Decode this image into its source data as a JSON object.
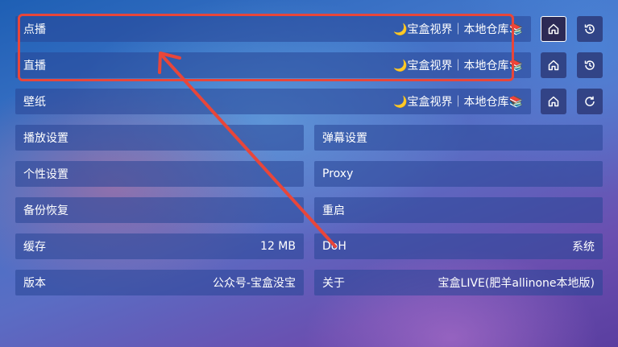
{
  "source_rows": [
    {
      "label": "点播",
      "value": "🌙宝盒视界｜本地仓库📚",
      "btn1": "home-icon",
      "btn2": "history-icon"
    },
    {
      "label": "直播",
      "value": "🌙宝盒视界｜本地仓库📚",
      "btn1": "home-icon",
      "btn2": "history-icon"
    },
    {
      "label": "壁纸",
      "value": "🌙宝盒视界｜本地仓库📚",
      "btn1": "home-icon",
      "btn2": "refresh-icon"
    }
  ],
  "settings": {
    "play_settings": "播放设置",
    "danmaku_settings": "弹幕设置",
    "personalize": "个性设置",
    "proxy": "Proxy",
    "backup": "备份恢复",
    "restart": "重启",
    "cache_label": "缓存",
    "cache_value": "12 MB",
    "doh_label": "DoH",
    "doh_value": "系统",
    "version_label": "版本",
    "version_value": "公众号-宝盒没宝",
    "about_label": "关于",
    "about_value": "宝盒LIVE(肥羊allinone本地版)"
  },
  "annotation": {
    "color": "#e8463a"
  }
}
